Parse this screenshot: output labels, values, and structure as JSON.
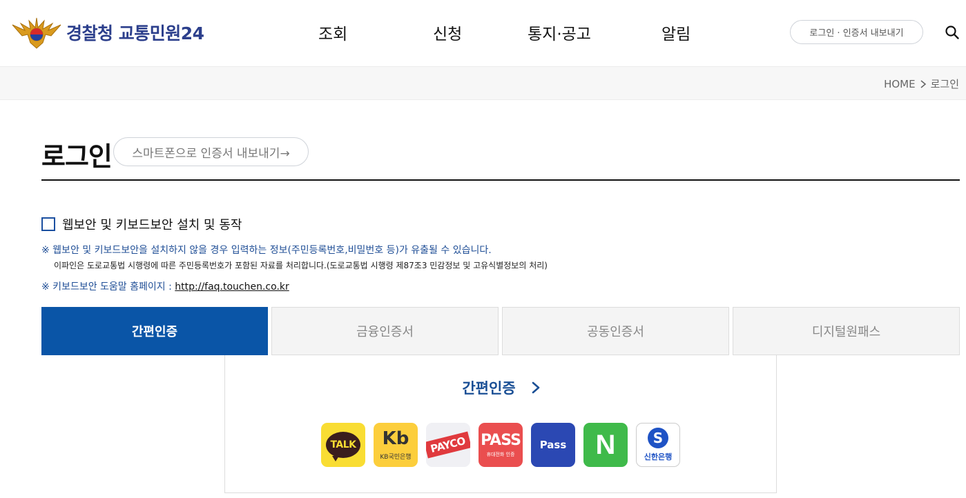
{
  "header": {
    "logo_text": "경찰청 교통민원24",
    "nav": [
      "조회",
      "신청",
      "통지·공고",
      "알림"
    ],
    "login_label": "로그인 · 인증서 내보내기"
  },
  "breadcrumb": {
    "home": "HOME",
    "current": "로그인"
  },
  "page": {
    "title": "로그인",
    "export_label": "스마트폰으로 인증서 내보내기→"
  },
  "security": {
    "checkbox_label": "웹보안 및 키보드보안 설치 및 동작",
    "checked": false,
    "notice1": "※ 웹보안 및 키보드보안을 설치하지 않을 경우 입력하는 정보(주민등록번호,비밀번호 등)가 유출될 수 있습니다.",
    "notice1_sub": "이파인은 도로교통법 시행령에 따른 주민등록번호가 포함된 자료를 처리합니다.(도로교통법 시행령 제87조3 민감정보 및 고유식별정보의 처리)",
    "notice2_prefix": "※ 키보드보안 도움말 홈페이지 : ",
    "notice2_link": "http://faq.touchen.co.kr"
  },
  "tabs": [
    "간편인증",
    "금융인증서",
    "공동인증서",
    "디지털원패스"
  ],
  "active_tab": "간편인증",
  "panel": {
    "title": "간편인증",
    "providers": {
      "kakao": "TALK",
      "kb_mark": "Kb",
      "kb": "KB국민은행",
      "payco": "PAYCO",
      "pass": "PASS",
      "pass_sub": "휴대전화 인증",
      "tpass": "Pass",
      "naver": "N",
      "shinhan_mark": "S",
      "shinhan": "신한은행"
    }
  },
  "colors": {
    "brand_navy": "#2c3f8c",
    "active_tab": "#0a55a7",
    "notice_blue": "#1f4e96"
  }
}
